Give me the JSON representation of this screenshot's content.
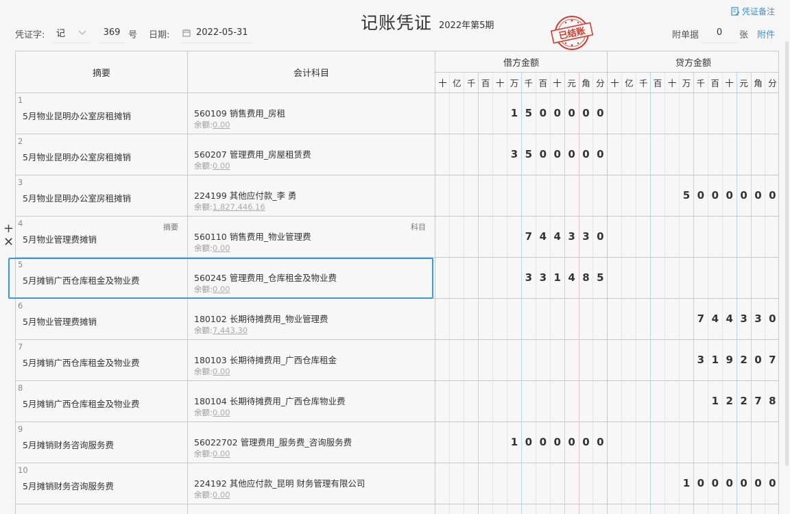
{
  "header": {
    "title": "记账凭证",
    "period": "2022年第5期",
    "stamp_text": "已结账",
    "remark_label": "凭证备注",
    "voucher_word_label": "凭证字:",
    "voucher_word_value": "记",
    "voucher_no": "369",
    "no_label": "号",
    "date_label": "日期:",
    "date_value": "2022-05-31",
    "attach_label": "附单据",
    "attach_count": "0",
    "attach_unit": "张",
    "attach_link": "附件"
  },
  "table": {
    "col_summary": "摘要",
    "col_account": "会计科目",
    "col_debit": "借方金额",
    "col_credit": "贷方金额",
    "units": [
      "十",
      "亿",
      "千",
      "百",
      "十",
      "万",
      "千",
      "百",
      "十",
      "元",
      "角",
      "分"
    ],
    "balance_label": "余额:",
    "hint_summary": "摘要",
    "hint_account": "科目",
    "rows": [
      {
        "no": "1",
        "summary": "5月物业昆明办公室房租摊销",
        "account": "560109 销售费用_房租",
        "balance": "0.00",
        "debit": "1500000",
        "credit": ""
      },
      {
        "no": "2",
        "summary": "5月物业昆明办公室房租摊销",
        "account": "560207 管理费用_房屋租赁费",
        "balance": "0.00",
        "debit": "3500000",
        "credit": ""
      },
      {
        "no": "3",
        "summary": "5月物业昆明办公室房租摊销",
        "account": "224199 其他应付款_李 勇",
        "balance": "1,827,446.16",
        "debit": "",
        "credit": "5000000"
      },
      {
        "no": "4",
        "summary": "5月物业管理费摊销",
        "account": "560110 销售费用_物业管理费",
        "balance": "0.00",
        "debit": "744330",
        "credit": ""
      },
      {
        "no": "5",
        "summary": "5月摊销广西仓库租金及物业费",
        "account": "560245 管理费用_仓库租金及物业费",
        "balance": "0.00",
        "debit": "331485",
        "credit": ""
      },
      {
        "no": "6",
        "summary": "5月物业管理费摊销",
        "account": "180102 长期待摊费用_物业管理费",
        "balance": "7,443.30",
        "debit": "",
        "credit": "744330"
      },
      {
        "no": "7",
        "summary": "5月摊销广西仓库租金及物业费",
        "account": "180103 长期待摊费用_广西仓库租金",
        "balance": "0.00",
        "debit": "",
        "credit": "319207"
      },
      {
        "no": "8",
        "summary": "5月摊销广西仓库租金及物业费",
        "account": "180104 长期待摊费用_广西仓库物业费",
        "balance": "0.00",
        "debit": "",
        "credit": "12278"
      },
      {
        "no": "9",
        "summary": "5月摊销财务咨询服务费",
        "account": "56022702 管理费用_服务费_咨询服务费",
        "balance": "0.00",
        "debit": "1000000",
        "credit": ""
      },
      {
        "no": "10",
        "summary": "5月摊销财务咨询服务费",
        "account": "224192 其他应付款_昆明 财务管理有限公司",
        "balance": "0.00",
        "debit": "",
        "credit": "1000000"
      }
    ]
  },
  "controls": {
    "add_row": "+",
    "delete_row": "✕"
  },
  "colors": {
    "accent": "#3a93d8",
    "stamp": "#d23a2d",
    "grid": "#c8c8c8"
  }
}
